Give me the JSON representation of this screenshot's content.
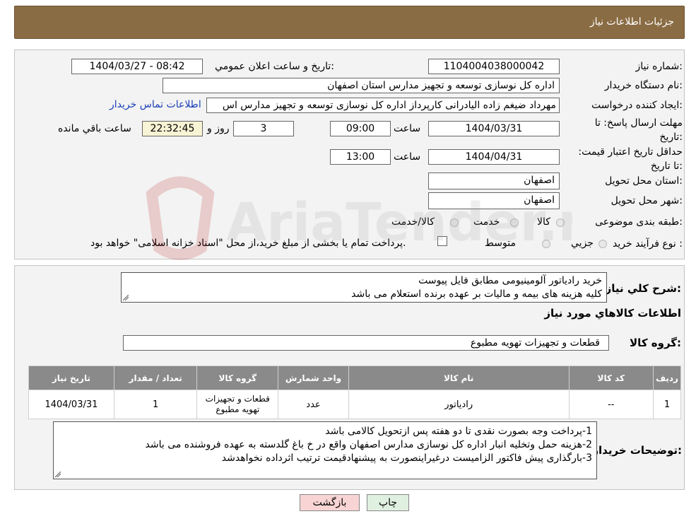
{
  "header": {
    "title": "جزئیات اطلاعات نیاز"
  },
  "form": {
    "need_number_label": "شماره نیاز:",
    "need_number": "1104004038000042",
    "announce_label": "تاریخ و ساعت اعلان عمومي:",
    "announce_value": "1404/03/27 - 08:42",
    "buyer_org_label": "نام دستگاه خريدار:",
    "buyer_org": "اداره کل نوسازی  توسعه و تجهیز مدارس استان اصفهان",
    "creator_label": "ايجاد کننده درخواست:",
    "creator": "مهرداد ضیغم زاده الیادرانی کارپرداز اداره کل نوسازی  توسعه و تجهیز مدارس اس",
    "contact_link": "اطلاعات تماس خريدار",
    "deadline_label": "مهلت ارسال پاسخ: تا تاریخ:",
    "deadline_date": "1404/03/31",
    "time_label": "ساعت",
    "deadline_time": "09:00",
    "days_value": "3",
    "days_label": "روز و",
    "remaining_time": "22:32:45",
    "remaining_label": "ساعت باقي مانده",
    "validity_label": "حداقل تاريخ اعتبار قيمت: تا تاریخ:",
    "validity_date": "1404/04/31",
    "validity_time": "13:00",
    "province_label": "استان محل تحويل:",
    "province": "اصفهان",
    "city_label": "شهر محل تحويل:",
    "city": "اصفهان",
    "category_label": "طبقه بندی موضوعی:",
    "category_options": [
      "کالا",
      "خدمت",
      "کالا/خدمت"
    ],
    "process_label": "نوع فرآيند خريد :",
    "process_options": [
      "جزيي",
      "متوسط"
    ],
    "process_note": "پرداخت تمام يا بخشی از مبلغ خريد،از محل \"اسناد خزانه اسلامی\" خواهد بود."
  },
  "description": {
    "label": "شرح کلي نياز:",
    "lines": [
      "خرید رادیاتور آلومینیومی مطابق فایل پیوست",
      "کلیه هزینه های بیمه و مالیات بر عهده برنده استعلام می باشد"
    ]
  },
  "goods": {
    "section_title": "اطلاعات کالاهاي مورد نياز",
    "group_label": "گروه کالا:",
    "group_value": "قطعات و تجهیزات تهویه مطبوع"
  },
  "table": {
    "headers": [
      "رديف",
      "کد کالا",
      "نام کالا",
      "واحد شمارش",
      "گروه کالا",
      "تعداد / مقدار",
      "تاريخ نياز"
    ],
    "rows": [
      [
        "1",
        "--",
        "رادیاتور",
        "عدد",
        "قطعات و تجهیزات تهویه مطبوع",
        "1",
        "1404/03/31"
      ]
    ]
  },
  "buyer_notes": {
    "label": "توضيحات خريدار:",
    "lines": [
      "1-پرداخت وجه بصورت نقدی تا دو هفته پس ازتحویل کالامی باشد",
      "2-هزینه حمل وتخلیه انبار اداره کل نوسازی مدارس اصفهان واقع در خ باغ گلدسته به عهده فروشنده می باشد",
      "3-بارگذاری پیش فاکتور الزامیست درغیراینصورت به پیشنهادقیمت ترتیب اثرداده نخواهدشد"
    ]
  },
  "buttons": {
    "print": "چاپ",
    "back": "بازگشت"
  },
  "watermark": {
    "text": "AriaTender.neT"
  },
  "colors": {
    "header_bg": "#8a6c44",
    "table_header_bg": "#8a8a8a",
    "remaining_bg": "#f7f3d4",
    "back_btn_bg": "#f8d4d4",
    "print_btn_bg": "#e0f0e0",
    "link": "#1a3fb8"
  }
}
